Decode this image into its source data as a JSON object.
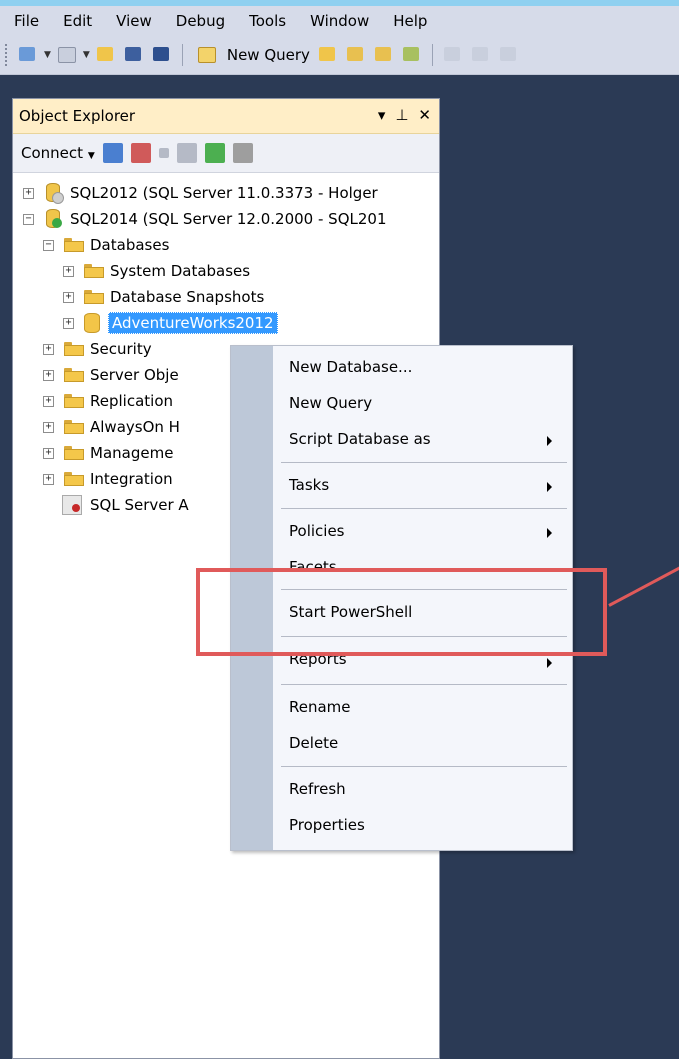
{
  "menubar": {
    "items": [
      "File",
      "Edit",
      "View",
      "Debug",
      "Tools",
      "Window",
      "Help"
    ]
  },
  "toolbar": {
    "new_query_label": "New Query"
  },
  "explorer": {
    "title": "Object Explorer",
    "pin": "▇ 为",
    "connect_label": "Connect",
    "tree": [
      "SQL2012 (SQL Server 11.0.3373 - Holger",
      "SQL2014 (SQL Server 12.0.2000 - SQL201",
      "Databases",
      "System Databases",
      "Database Snapshots",
      "AdventureWorks2012",
      "Security",
      "Server Obje",
      "Replication",
      "AlwaysOn H",
      "Manageme",
      "Integration",
      "SQL Server A"
    ]
  },
  "context_menu": {
    "items": [
      "New Database...",
      "New Query",
      "Script Database as",
      "Tasks",
      "Policies",
      "Facets",
      "Start PowerShell",
      "Reports",
      "Rename",
      "Delete",
      "Refresh",
      "Properties"
    ]
  }
}
